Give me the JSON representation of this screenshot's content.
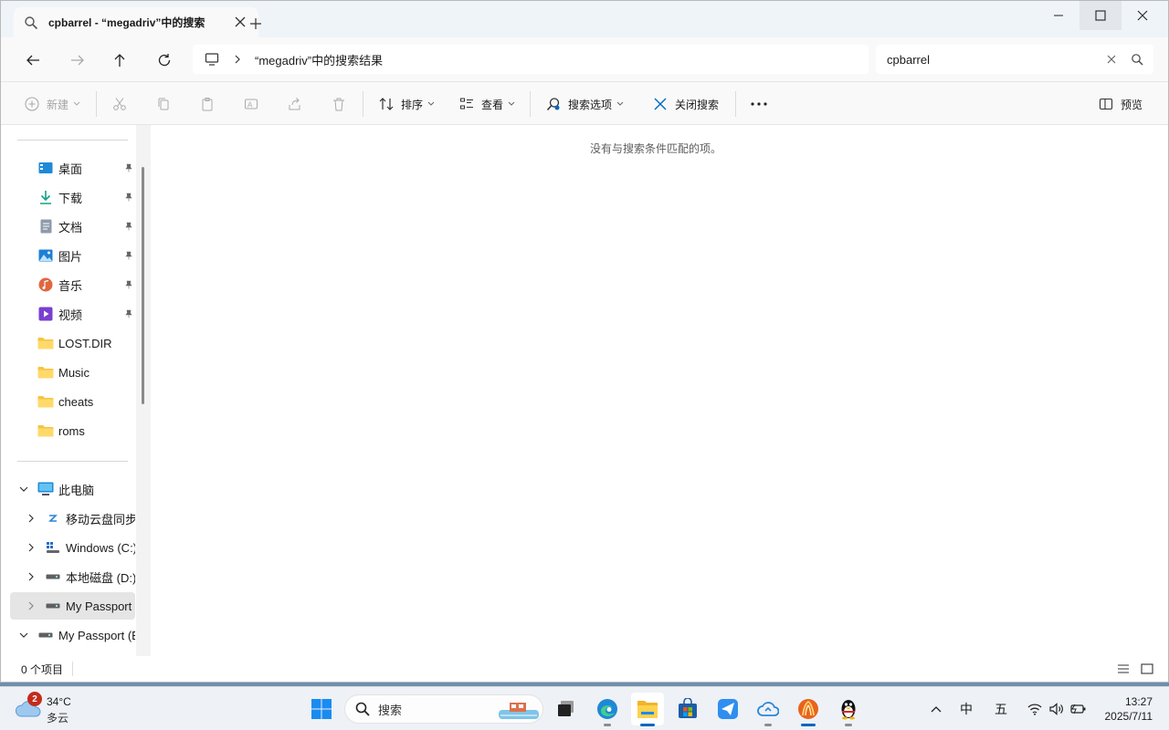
{
  "window": {
    "tab_title": "cpbarrel - “megadriv”中的搜索",
    "address_text": "“megadriv”中的搜索结果",
    "search_value": "cpbarrel"
  },
  "toolbar": {
    "new_label": "新建",
    "sort_label": "排序",
    "view_label": "查看",
    "search_options_label": "搜索选项",
    "close_search_label": "关闭搜索",
    "preview_label": "预览"
  },
  "sidebar": {
    "quick_access": [
      {
        "label": "桌面",
        "icon": "desktop-icon",
        "pinned": true
      },
      {
        "label": "下载",
        "icon": "download-icon",
        "pinned": true
      },
      {
        "label": "文档",
        "icon": "document-icon",
        "pinned": true
      },
      {
        "label": "图片",
        "icon": "pictures-icon",
        "pinned": true
      },
      {
        "label": "音乐",
        "icon": "music-icon",
        "pinned": true
      },
      {
        "label": "视频",
        "icon": "videos-icon",
        "pinned": true
      },
      {
        "label": "LOST.DIR",
        "icon": "folder-icon",
        "pinned": false
      },
      {
        "label": "Music",
        "icon": "folder-icon",
        "pinned": false
      },
      {
        "label": "cheats",
        "icon": "folder-icon",
        "pinned": false
      },
      {
        "label": "roms",
        "icon": "folder-icon",
        "pinned": false
      }
    ],
    "this_pc": {
      "label": "此电脑",
      "expanded": true
    },
    "drives": [
      {
        "label": "移动云盘同步盘",
        "icon": "cloud-drive-icon",
        "expanded": false,
        "selected": false
      },
      {
        "label": "Windows (C:)",
        "icon": "windows-drive-icon",
        "expanded": false,
        "selected": false
      },
      {
        "label": "本地磁盘 (D:)",
        "icon": "drive-icon",
        "expanded": false,
        "selected": false
      },
      {
        "label": "My Passport (E:)",
        "icon": "drive-icon",
        "expanded": false,
        "selected": true
      }
    ],
    "external": {
      "label": "My Passport (E:)",
      "expanded": true
    }
  },
  "content": {
    "empty_message": "没有与搜索条件匹配的项。"
  },
  "status": {
    "item_count": "0 个项目"
  },
  "taskbar": {
    "weather_temp": "34°C",
    "weather_desc": "多云",
    "weather_badge": "2",
    "search_placeholder": "搜索",
    "ime_lang": "中",
    "ime_mode": "五",
    "time": "13:27",
    "date": "2025/7/11"
  },
  "colors": {
    "accent": "#0067c0",
    "folder": "#f4c542",
    "titlebar_bg": "#eff4f9",
    "toolbar_bg": "#f9f9f9"
  }
}
